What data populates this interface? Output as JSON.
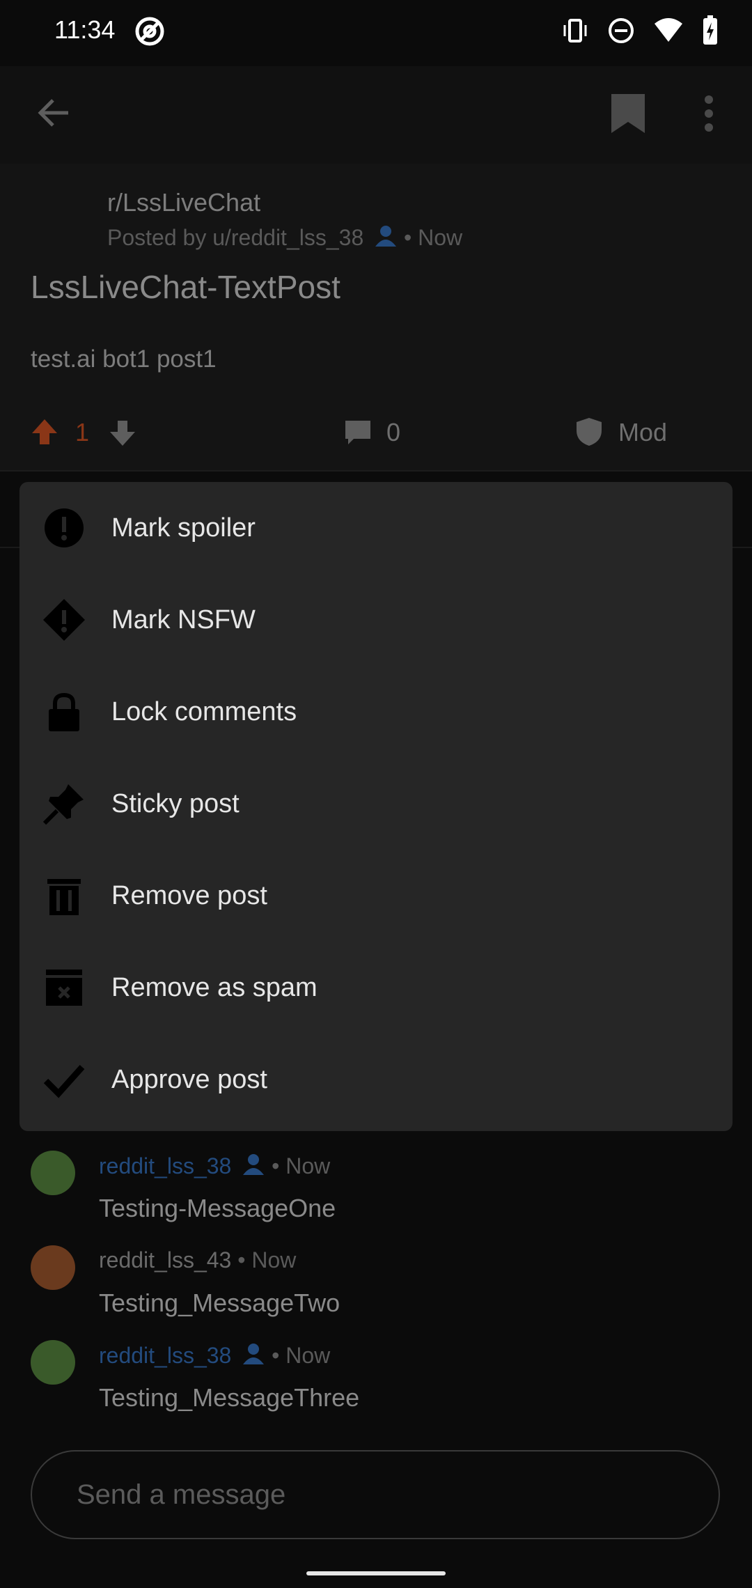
{
  "status_bar": {
    "time": "11:34"
  },
  "post": {
    "subreddit": "r/LssLiveChat",
    "posted_by": "Posted by u/reddit_lss_38",
    "posted_time": "• Now",
    "title": "LssLiveChat-TextPost",
    "body": "test.ai bot1 post1",
    "vote_count": "1",
    "comment_count": "0",
    "mod_label": "Mod"
  },
  "menu": {
    "items": [
      {
        "label": "Mark spoiler",
        "icon": "exclamation-circle-icon"
      },
      {
        "label": "Mark NSFW",
        "icon": "exclamation-diamond-icon"
      },
      {
        "label": "Lock comments",
        "icon": "lock-icon"
      },
      {
        "label": "Sticky post",
        "icon": "pin-icon"
      },
      {
        "label": "Remove post",
        "icon": "trash-icon"
      },
      {
        "label": "Remove as spam",
        "icon": "spam-box-icon"
      },
      {
        "label": "Approve post",
        "icon": "check-icon"
      }
    ]
  },
  "chat": {
    "messages": [
      {
        "user": "reddit_lss_38",
        "time": "• Now",
        "text": "Testing-MessageOne",
        "is_op": true
      },
      {
        "user": "reddit_lss_43",
        "time": "• Now",
        "text": "Testing_MessageTwo",
        "is_op": false
      },
      {
        "user": "reddit_lss_38",
        "time": "• Now",
        "text": "Testing_MessageThree",
        "is_op": true
      }
    ]
  },
  "input": {
    "placeholder": "Send a message"
  },
  "colors": {
    "background": "#0b0b0b",
    "menu": "#262626",
    "upvote": "#8a3617",
    "op_user": "#234b7e"
  }
}
